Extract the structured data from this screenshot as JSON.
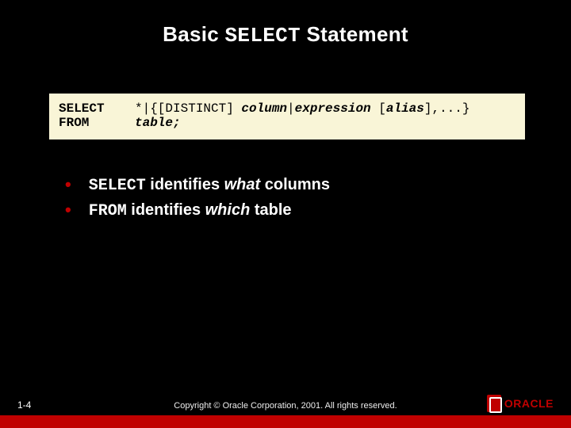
{
  "title": {
    "pre": "Basic ",
    "mono": "SELECT",
    "post": " Statement"
  },
  "code": {
    "line1": {
      "kw": "SELECT",
      "rest_a": "*|{[DISTINCT] ",
      "ital_a": "column",
      "mid": "|",
      "ital_b": "expression",
      "rest_b": " [",
      "ital_c": "alias",
      "rest_c": "],...}"
    },
    "line2": {
      "kw": "FROM",
      "ital": "table;",
      "rest": ""
    }
  },
  "bullets": [
    {
      "mono": "SELECT",
      "mid": " identifies ",
      "em": "what",
      "tail": " columns"
    },
    {
      "mono": "FROM",
      "mid": " identifies ",
      "em": "which",
      "tail": " table"
    }
  ],
  "footer": {
    "pagenum": "1-4",
    "copyright": "Copyright © Oracle Corporation, 2001. All rights reserved.",
    "logo_text": "ORACLE"
  }
}
